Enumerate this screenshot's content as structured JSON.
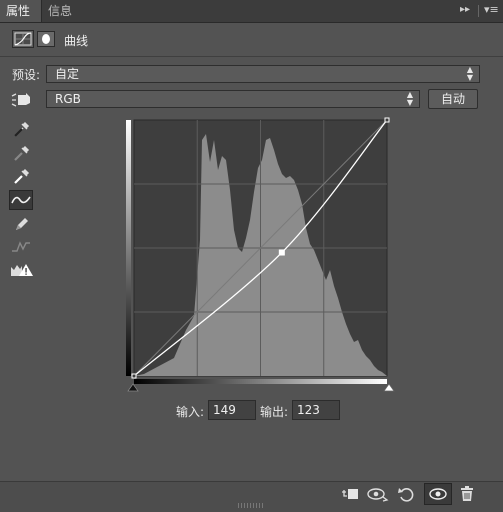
{
  "tabs": [
    {
      "label": "属性",
      "active": true
    },
    {
      "label": "信息",
      "active": false
    }
  ],
  "tabbar_icons": {
    "collapse": "double-chevron-icon",
    "menu": "panel-menu-icon"
  },
  "header": {
    "title": "曲线",
    "icons": [
      "curves-adjustment-icon",
      "layer-mask-icon"
    ]
  },
  "preset": {
    "label": "预设:",
    "value": "自定"
  },
  "channel": {
    "value": "RGB",
    "auto_label": "自动"
  },
  "tools": [
    {
      "name": "eyedropper-black-point-icon",
      "selected": false
    },
    {
      "name": "eyedropper-gray-point-icon",
      "selected": false
    },
    {
      "name": "eyedropper-white-point-icon",
      "selected": false
    },
    {
      "name": "curve-edit-points-icon",
      "selected": true
    },
    {
      "name": "pencil-draw-icon",
      "selected": false
    },
    {
      "name": "smooth-curve-icon",
      "selected": false
    },
    {
      "name": "clipping-warning-icon",
      "selected": false
    }
  ],
  "curve": {
    "points": [
      [
        0,
        0
      ],
      [
        149,
        123
      ],
      [
        255,
        255
      ]
    ],
    "selected_point": [
      149,
      123
    ],
    "range": [
      0,
      255
    ]
  },
  "fields": {
    "input_label": "输入:",
    "input_value": "149",
    "output_label": "输出:",
    "output_value": "123"
  },
  "bottom_icons": [
    "clip-to-layer-icon",
    "view-previous-state-icon",
    "reset-icon",
    "visibility-eye-icon",
    "trash-icon"
  ],
  "colors": {
    "panel_bg": "#535353",
    "graph_bg": "#3e3e3e",
    "histogram": "#8c8c8c",
    "curve": "#ffffff"
  }
}
